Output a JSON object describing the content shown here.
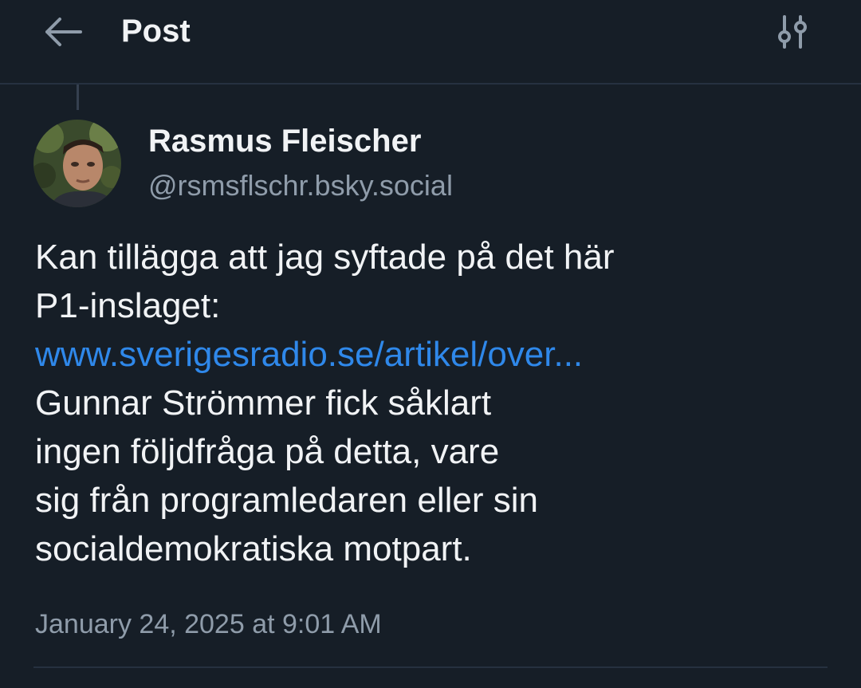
{
  "header": {
    "title": "Post",
    "back_icon": "arrow-left-icon",
    "filter_icon": "sliders-icon"
  },
  "post": {
    "author": {
      "display_name": "Rasmus Fleischer",
      "handle": "@rsmsflschr.bsky.social"
    },
    "text_lines_before_link": [
      "Kan tillägga att jag syftade på det här",
      "P1-inslaget:"
    ],
    "link_text": "www.sverigesradio.se/artikel/over...",
    "text_lines_after_link": [
      "Gunnar Strömmer fick såklart",
      "ingen följdfråga på detta, vare",
      "sig från programledaren eller sin",
      "socialdemokratiska motpart."
    ],
    "timestamp": "January 24, 2025 at 9:01 AM"
  },
  "colors": {
    "background": "#161e27",
    "text": "#f1f3f5",
    "muted": "#8f9caa",
    "link": "#2f88ea",
    "divider": "#263140"
  }
}
